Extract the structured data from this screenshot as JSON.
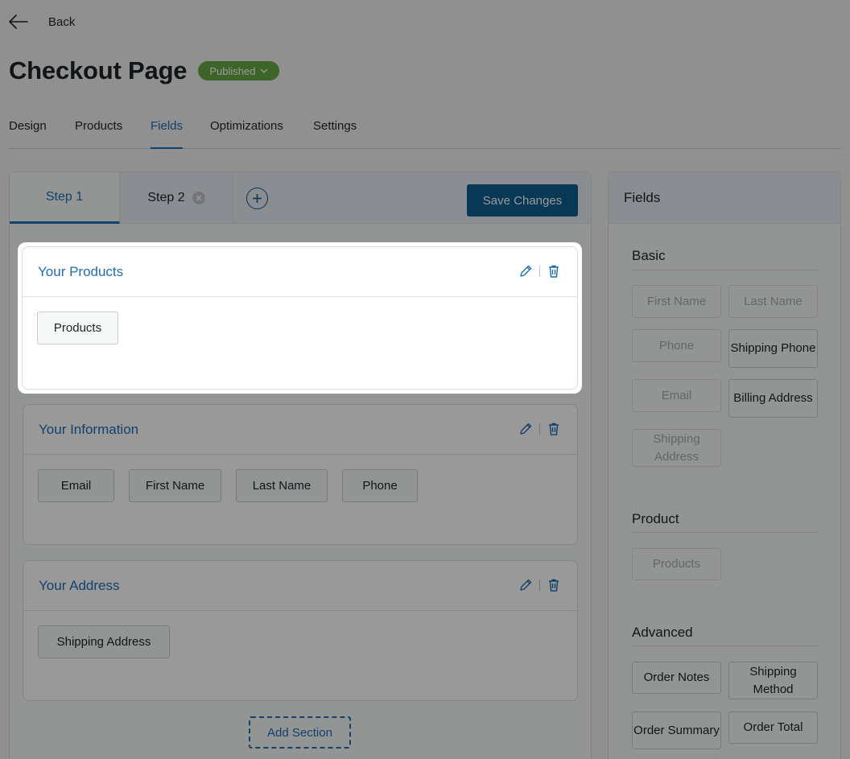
{
  "header": {
    "back_label": "Back",
    "page_title": "Checkout Page",
    "status": "Published"
  },
  "tabs": [
    {
      "label": "Design"
    },
    {
      "label": "Products"
    },
    {
      "label": "Fields",
      "active": true
    },
    {
      "label": "Optimizations"
    },
    {
      "label": "Settings"
    }
  ],
  "steps": {
    "step1": "Step 1",
    "step2": "Step 2",
    "save_label": "Save Changes"
  },
  "sections": [
    {
      "title": "Your Products",
      "fields": [
        "Products"
      ]
    },
    {
      "title": "Your Information",
      "fields": [
        "Email",
        "First Name",
        "Last Name",
        "Phone"
      ]
    },
    {
      "title": "Your Address",
      "fields": [
        "Shipping Address"
      ]
    }
  ],
  "add_section_label": "Add Section",
  "fields_panel": {
    "title": "Fields",
    "groups": [
      {
        "title": "Basic",
        "items": [
          "First Name",
          "Last Name",
          "Phone",
          "Shipping Phone",
          "Email",
          "Billing Address",
          "Shipping Address"
        ]
      },
      {
        "title": "Product",
        "items": [
          "Products"
        ]
      },
      {
        "title": "Advanced",
        "items": [
          "Order Notes",
          "Shipping Method",
          "Order Summary",
          "Order Total"
        ]
      }
    ]
  },
  "colors": {
    "accent": "#1e6db3",
    "primary_button": "#0c5f8f",
    "published": "#66a845"
  }
}
